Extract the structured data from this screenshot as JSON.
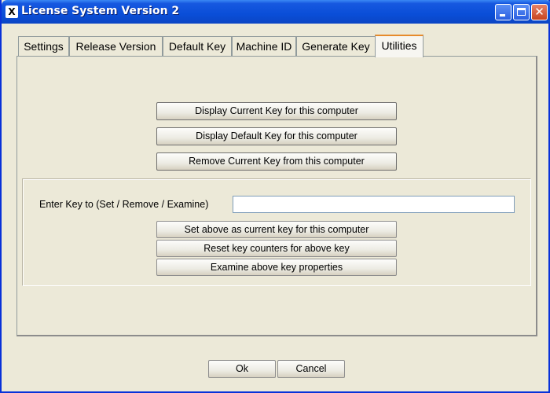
{
  "window": {
    "title": "License System Version 2",
    "icon_glyph": "X",
    "icon": "app-icon",
    "controls": [
      "minimize-icon",
      "maximize-icon",
      "close-icon"
    ]
  },
  "tabs": [
    {
      "label": "Settings",
      "active": false
    },
    {
      "label": "Release Version",
      "active": false
    },
    {
      "label": "Default Key",
      "active": false
    },
    {
      "label": "Machine ID",
      "active": false
    },
    {
      "label": "Generate Key",
      "active": false
    },
    {
      "label": "Utilities",
      "active": true
    }
  ],
  "utilities": {
    "display_current_key": "Display Current Key for this computer",
    "display_default_key": "Display Default Key for this computer",
    "remove_current_key": "Remove Current Key from this computer",
    "key_label": "Enter Key to (Set / Remove / Examine)",
    "key_value": "",
    "set_current_key": "Set above as current key for this computer",
    "reset_counters": "Reset key counters for above key",
    "examine_properties": "Examine above key properties"
  },
  "footer": {
    "ok": "Ok",
    "cancel": "Cancel"
  },
  "colors": {
    "titlebar": "#0a4ed8",
    "background": "#ece9d8",
    "active_tab_accent": "#e68b2c"
  }
}
